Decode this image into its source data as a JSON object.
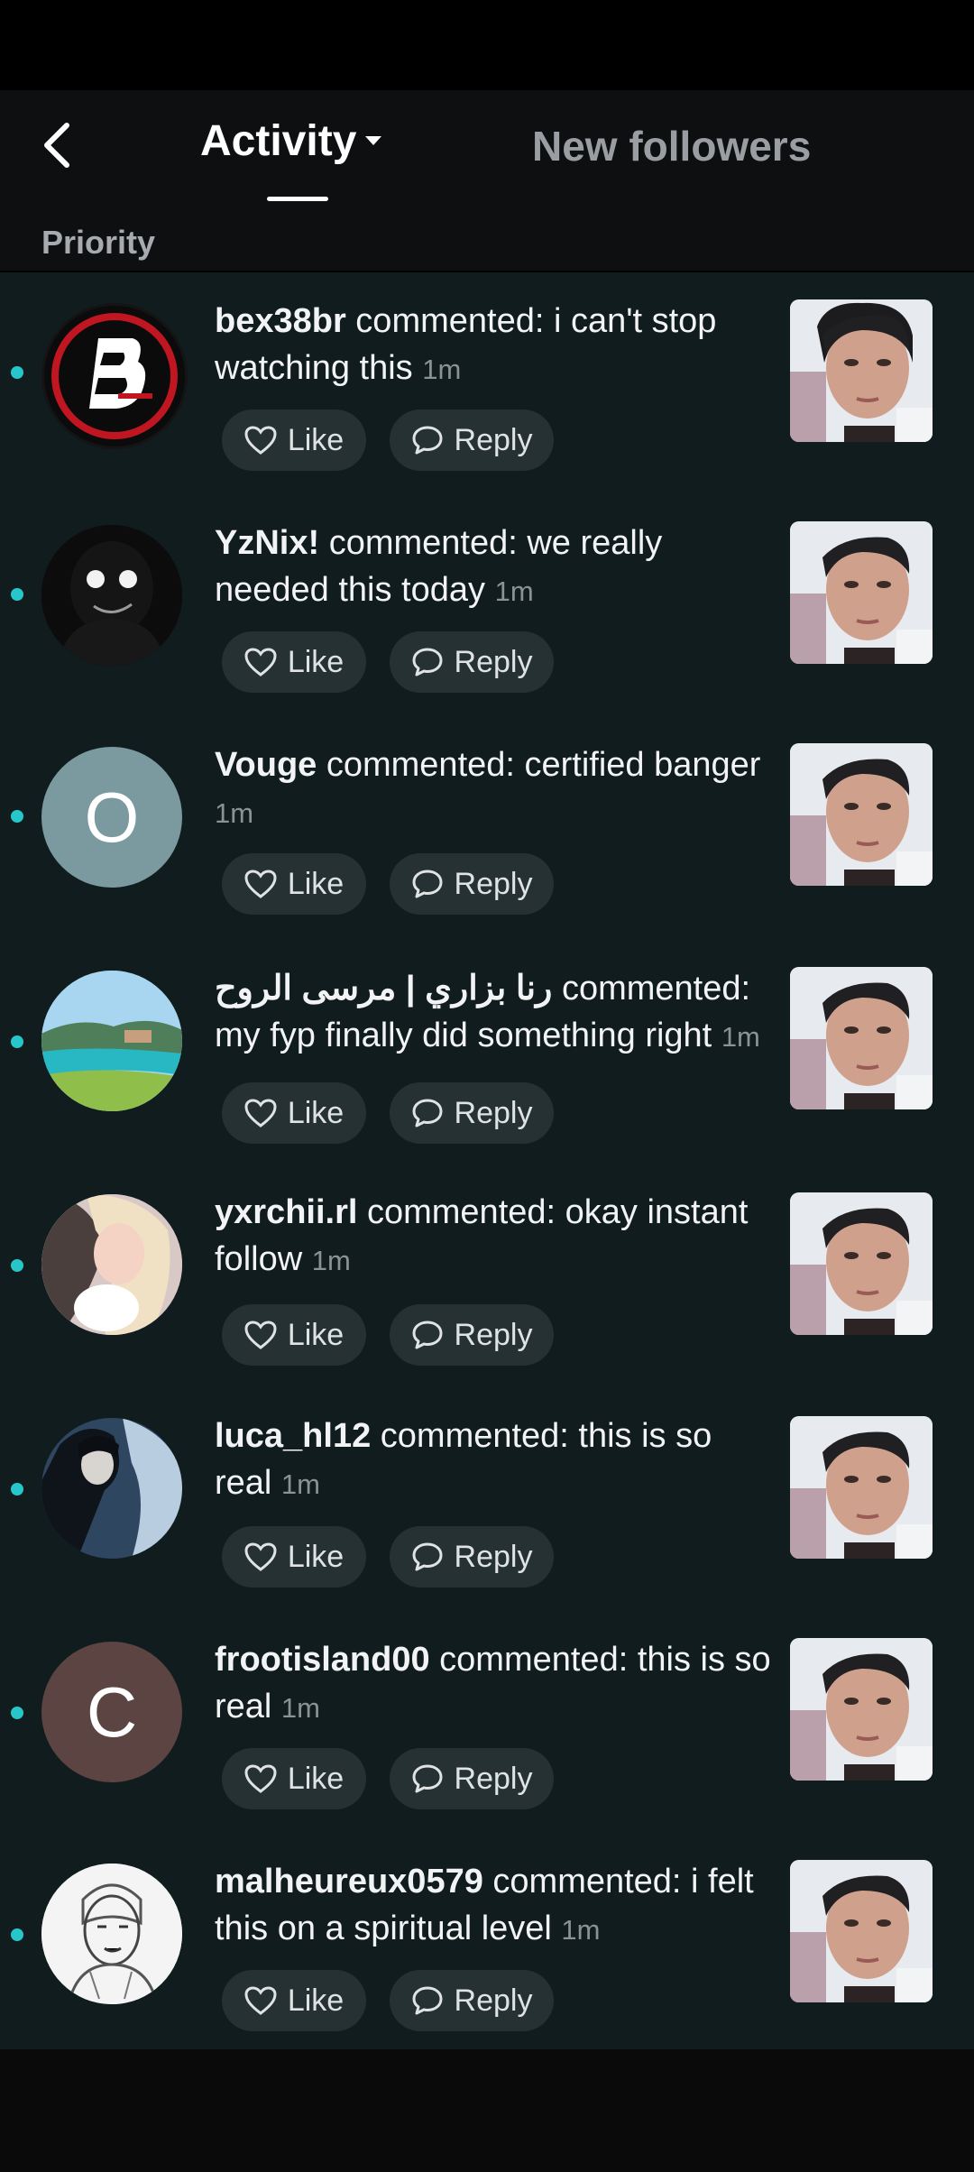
{
  "header": {
    "tab_activity": "Activity",
    "tab_followers": "New followers"
  },
  "section_label": "Priority",
  "items": [
    {
      "user": "bex38br",
      "text": " commented: i can't stop watching this ",
      "time": "1m"
    },
    {
      "user": "YzNix!",
      "text": " commented: we really needed this today ",
      "time": "1m"
    },
    {
      "user": "Vouge",
      "text": " commented: certified banger ",
      "time": "1m",
      "initial": "O"
    },
    {
      "user": "رنا بزاري | مرسى الروح",
      "text": " commented: my fyp finally did something right ",
      "time": "1m"
    },
    {
      "user": "yxrchii.rl",
      "text": " commented: okay instant follow ",
      "time": "1m"
    },
    {
      "user": "luca_hl12",
      "text": " commented: this is so real ",
      "time": "1m"
    },
    {
      "user": "frootisland00",
      "text": " commented: this is so real ",
      "time": "1m",
      "initial": "C"
    },
    {
      "user": "malheureux0579",
      "text": " commented: i felt this on a spiritual level ",
      "time": "1m"
    }
  ],
  "actions": {
    "like_label": "Like",
    "reply_label": "Reply"
  },
  "colors": {
    "unread_dot": "#27c7c9",
    "list_background": "#111c1e"
  }
}
